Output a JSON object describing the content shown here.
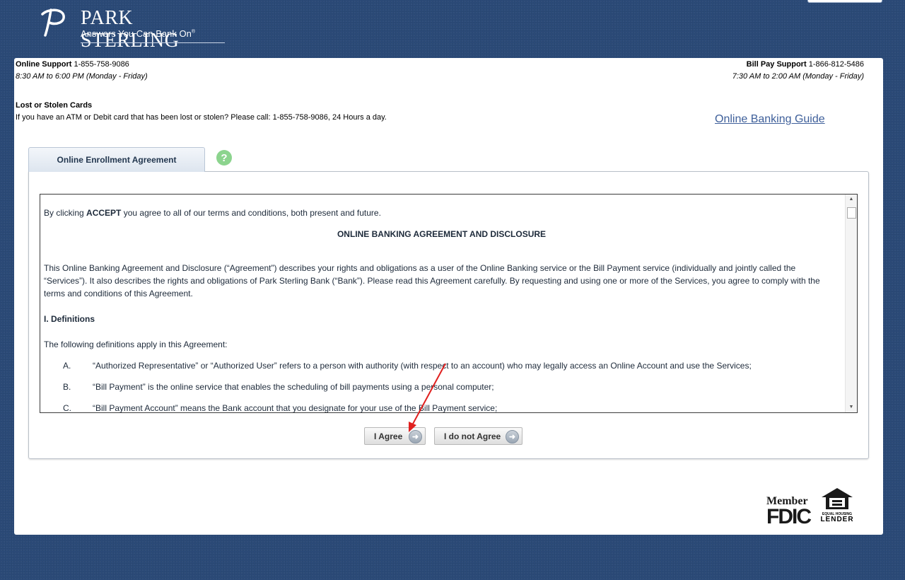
{
  "brand": {
    "name": "PARK STERLING",
    "tagline": "Answers You Can Bank On",
    "reg": "®"
  },
  "support": {
    "online_label": "Online Support",
    "online_phone": "1-855-758-9086",
    "online_hours": "8:30 AM to 6:00 PM (Monday - Friday)",
    "billpay_label": "Bill Pay Support",
    "billpay_phone": "1-866-812-5486",
    "billpay_hours": "7:30 AM to 2:00 AM (Monday - Friday)"
  },
  "lost": {
    "title": "Lost or Stolen Cards",
    "text": "If you have an ATM or Debit card that has been lost or stolen? Please call: 1-855-758-9086, 24 Hours a day."
  },
  "guide_link": "Online Banking Guide",
  "tab": {
    "label": "Online Enrollment Agreement",
    "help": "?"
  },
  "agreement": {
    "intro_pre": "By clicking ",
    "intro_bold": "ACCEPT",
    "intro_post": " you agree to all of our terms and conditions, both present and future.",
    "heading": "ONLINE BANKING AGREEMENT AND DISCLOSURE",
    "para1": "This Online Banking Agreement and Disclosure (“Agreement”) describes your rights and obligations as a user of the Online Banking service or the Bill Payment service (individually and jointly called the “Services”). It also describes the rights and obligations of Park Sterling Bank (“Bank”). Please read this Agreement carefully. By requesting and using one or more of the Services, you agree to comply with the terms and conditions of this Agreement.",
    "section": "I. Definitions",
    "defs_intro": "The following definitions apply in this Agreement:",
    "defs": [
      {
        "k": "A.",
        "t": "“Authorized Representative” or “Authorized User” refers to a person with authority (with respect to an account) who may legally access an Online Account and use the Services;"
      },
      {
        "k": "B.",
        "t": "“Bill Payment” is the online service that enables the scheduling of bill payments using a personal computer;"
      },
      {
        "k": "C.",
        "t": "“Bill Payment Account” means the Bank account that you designate for your use of the Bill Payment service;"
      }
    ]
  },
  "buttons": {
    "agree": "I Agree",
    "disagree": "I do not Agree"
  },
  "footer": {
    "member": "Member",
    "fdic": "FDIC",
    "ehl_small": "EQUAL HOUSING",
    "ehl_large": "LENDER"
  },
  "colors": {
    "background": "#2b4a78",
    "link": "#3e5f9a",
    "help": "#8cd48e",
    "annotation_arrow": "#e0201f"
  }
}
